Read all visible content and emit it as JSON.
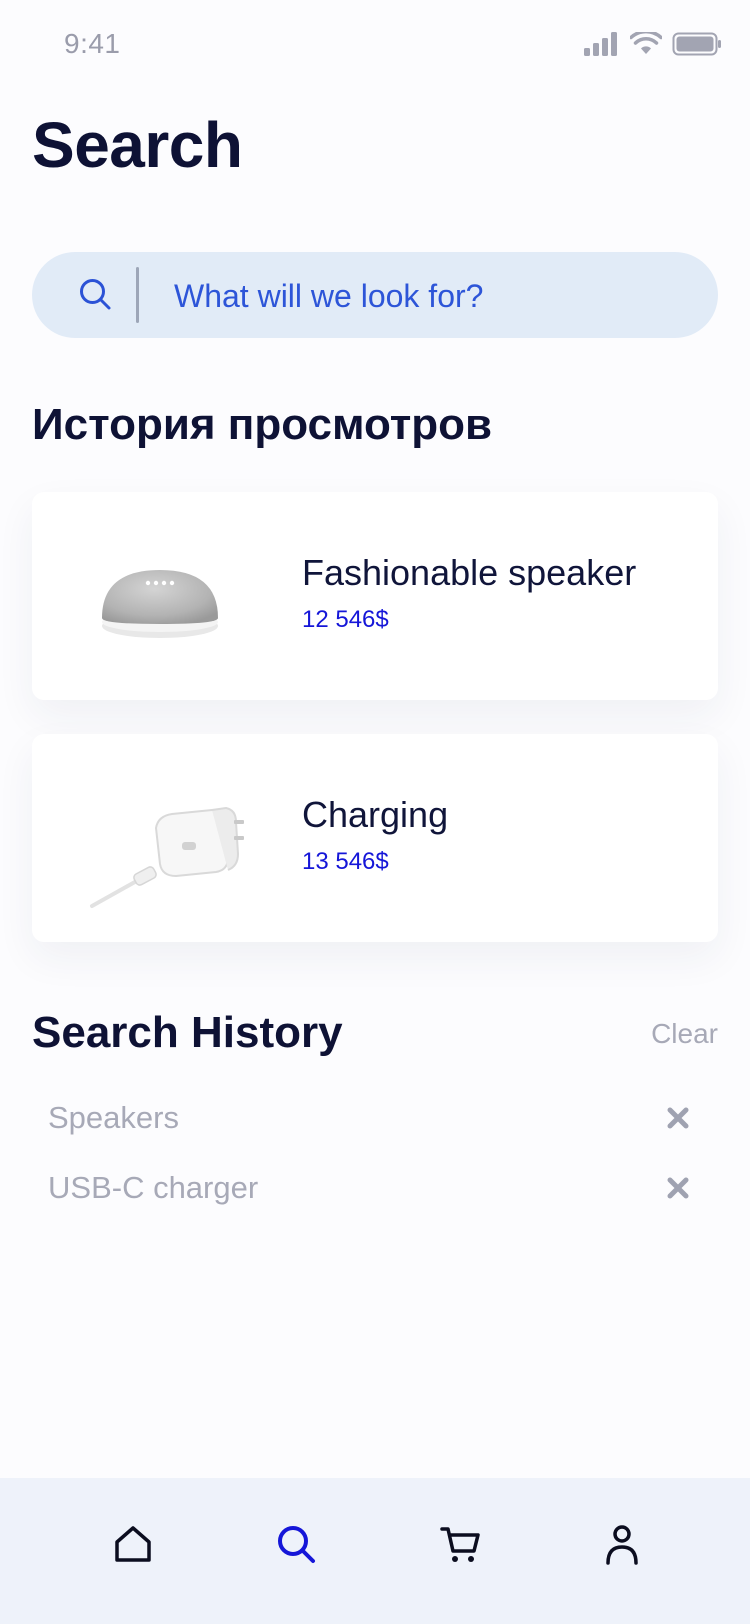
{
  "status_bar": {
    "time": "9:41"
  },
  "header": {
    "title": "Search"
  },
  "search": {
    "placeholder": "What will we look for?"
  },
  "viewed": {
    "title": "История просмотров",
    "items": [
      {
        "name": "Fashionable speaker",
        "price": "12 546$",
        "icon": "speaker-image"
      },
      {
        "name": "Charging",
        "price": "13 546$",
        "icon": "charger-image"
      }
    ]
  },
  "search_history": {
    "title": "Search History",
    "clear_label": "Clear",
    "items": [
      {
        "text": "Speakers"
      },
      {
        "text": "USB-C charger"
      }
    ]
  },
  "tab_bar": {
    "items": [
      {
        "name": "home",
        "icon": "home-icon"
      },
      {
        "name": "search",
        "icon": "search-icon",
        "active": true
      },
      {
        "name": "cart",
        "icon": "cart-icon"
      },
      {
        "name": "profile",
        "icon": "profile-icon"
      }
    ]
  },
  "colors": {
    "accent": "#1516d8",
    "search_bg": "#e1ebf7",
    "text_dark": "#10153a",
    "text_muted": "#a7a9b7",
    "tab_bar_bg": "#eef2fa"
  }
}
